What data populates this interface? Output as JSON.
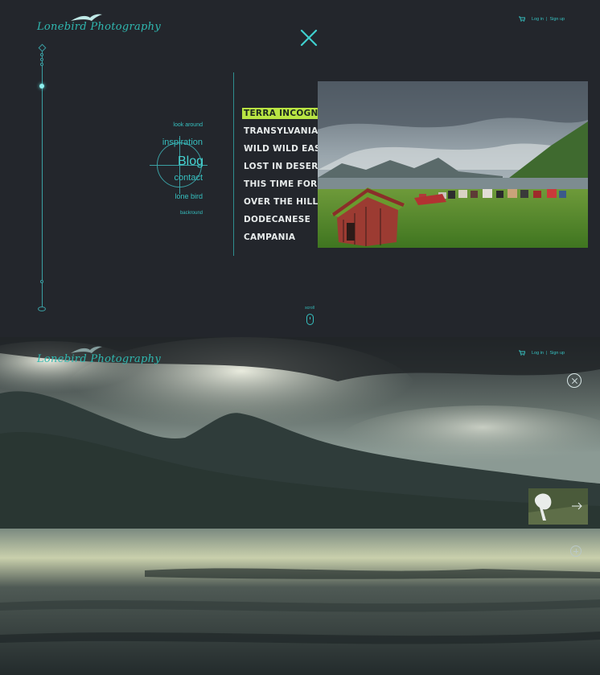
{
  "brand": {
    "logo_text": "Lonebird Photography"
  },
  "auth": {
    "login": "Log in",
    "separator": "|",
    "signup": "Sign up"
  },
  "nav": {
    "items": [
      "look around",
      "inspiration",
      "Blog",
      "contact",
      "lone bird",
      "backround"
    ]
  },
  "posts": [
    "TERRA INCOGNITA",
    "TRANSYLVANIA DREAMIN’",
    "WILD WILD EAST",
    "LOST IN DESERT",
    "THIS TIME FOR AFRICA",
    "OVER THE HILLS",
    "DODECANESE",
    "CAMPANIA"
  ],
  "scroll": {
    "label": "scroll"
  },
  "colors": {
    "accent": "#3cc6c6",
    "highlight": "#b9e543",
    "background": "#23262c"
  },
  "icons": [
    "bird-logo-icon",
    "cart-icon",
    "close-icon",
    "scroll-mouse-icon",
    "arrow-right-icon",
    "plus-icon"
  ]
}
